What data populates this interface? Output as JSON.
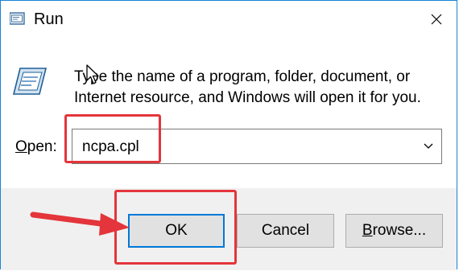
{
  "window": {
    "title": "Run",
    "description_line1": "Type the name of a program, folder, document, or",
    "description_line2": "Internet resource, and Windows will open it for you."
  },
  "open_field": {
    "label_underlined": "O",
    "label_rest": "pen:",
    "value": "ncpa.cpl"
  },
  "buttons": {
    "ok": "OK",
    "cancel": "Cancel",
    "browse_underlined": "B",
    "browse_rest": "rowse..."
  },
  "colors": {
    "annotation": "#e3353b",
    "window_border": "#1883d7",
    "default_button_border": "#0078d7",
    "footer_bg": "#f0f0f0"
  },
  "icons": [
    "run-app-icon",
    "close-icon",
    "run-program-icon",
    "mouse-cursor-icon",
    "chevron-down-icon",
    "annotation-arrow-icon"
  ]
}
